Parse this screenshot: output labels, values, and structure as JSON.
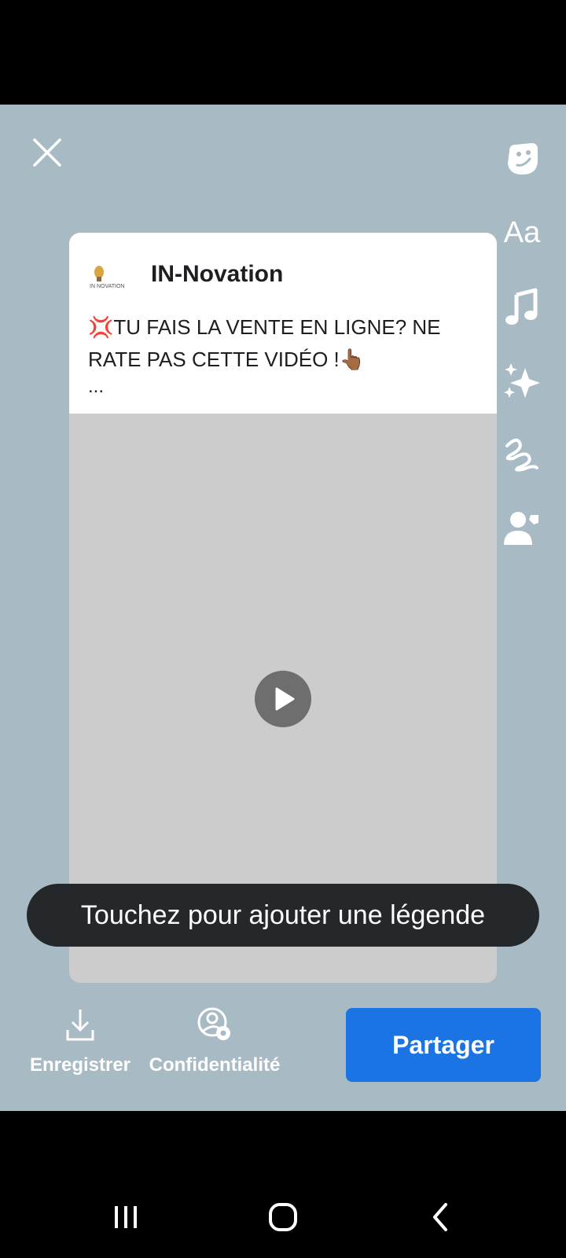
{
  "editor": {
    "close_icon": "close-icon",
    "tools": [
      "sticker-icon",
      "text-icon",
      "music-icon",
      "effects-icon",
      "scribble-icon",
      "tag-people-icon"
    ],
    "text_tool_label": "Aa"
  },
  "post": {
    "page_name": "IN-Novation",
    "logo_label": "IN NOVATION",
    "text": "💢TU FAIS LA VENTE EN LIGNE? NE RATE PAS CETTE VIDÉO !👆🏾",
    "ellipsis": "...",
    "play_icon": "play-icon"
  },
  "caption": {
    "placeholder": "Touchez pour ajouter une légende"
  },
  "actions": {
    "save_label": "Enregistrer",
    "privacy_label": "Confidentialité",
    "share_label": "Partager"
  },
  "colors": {
    "background": "#a8bac4",
    "share_button": "#1b74e4",
    "caption_pill": "#25282a"
  }
}
